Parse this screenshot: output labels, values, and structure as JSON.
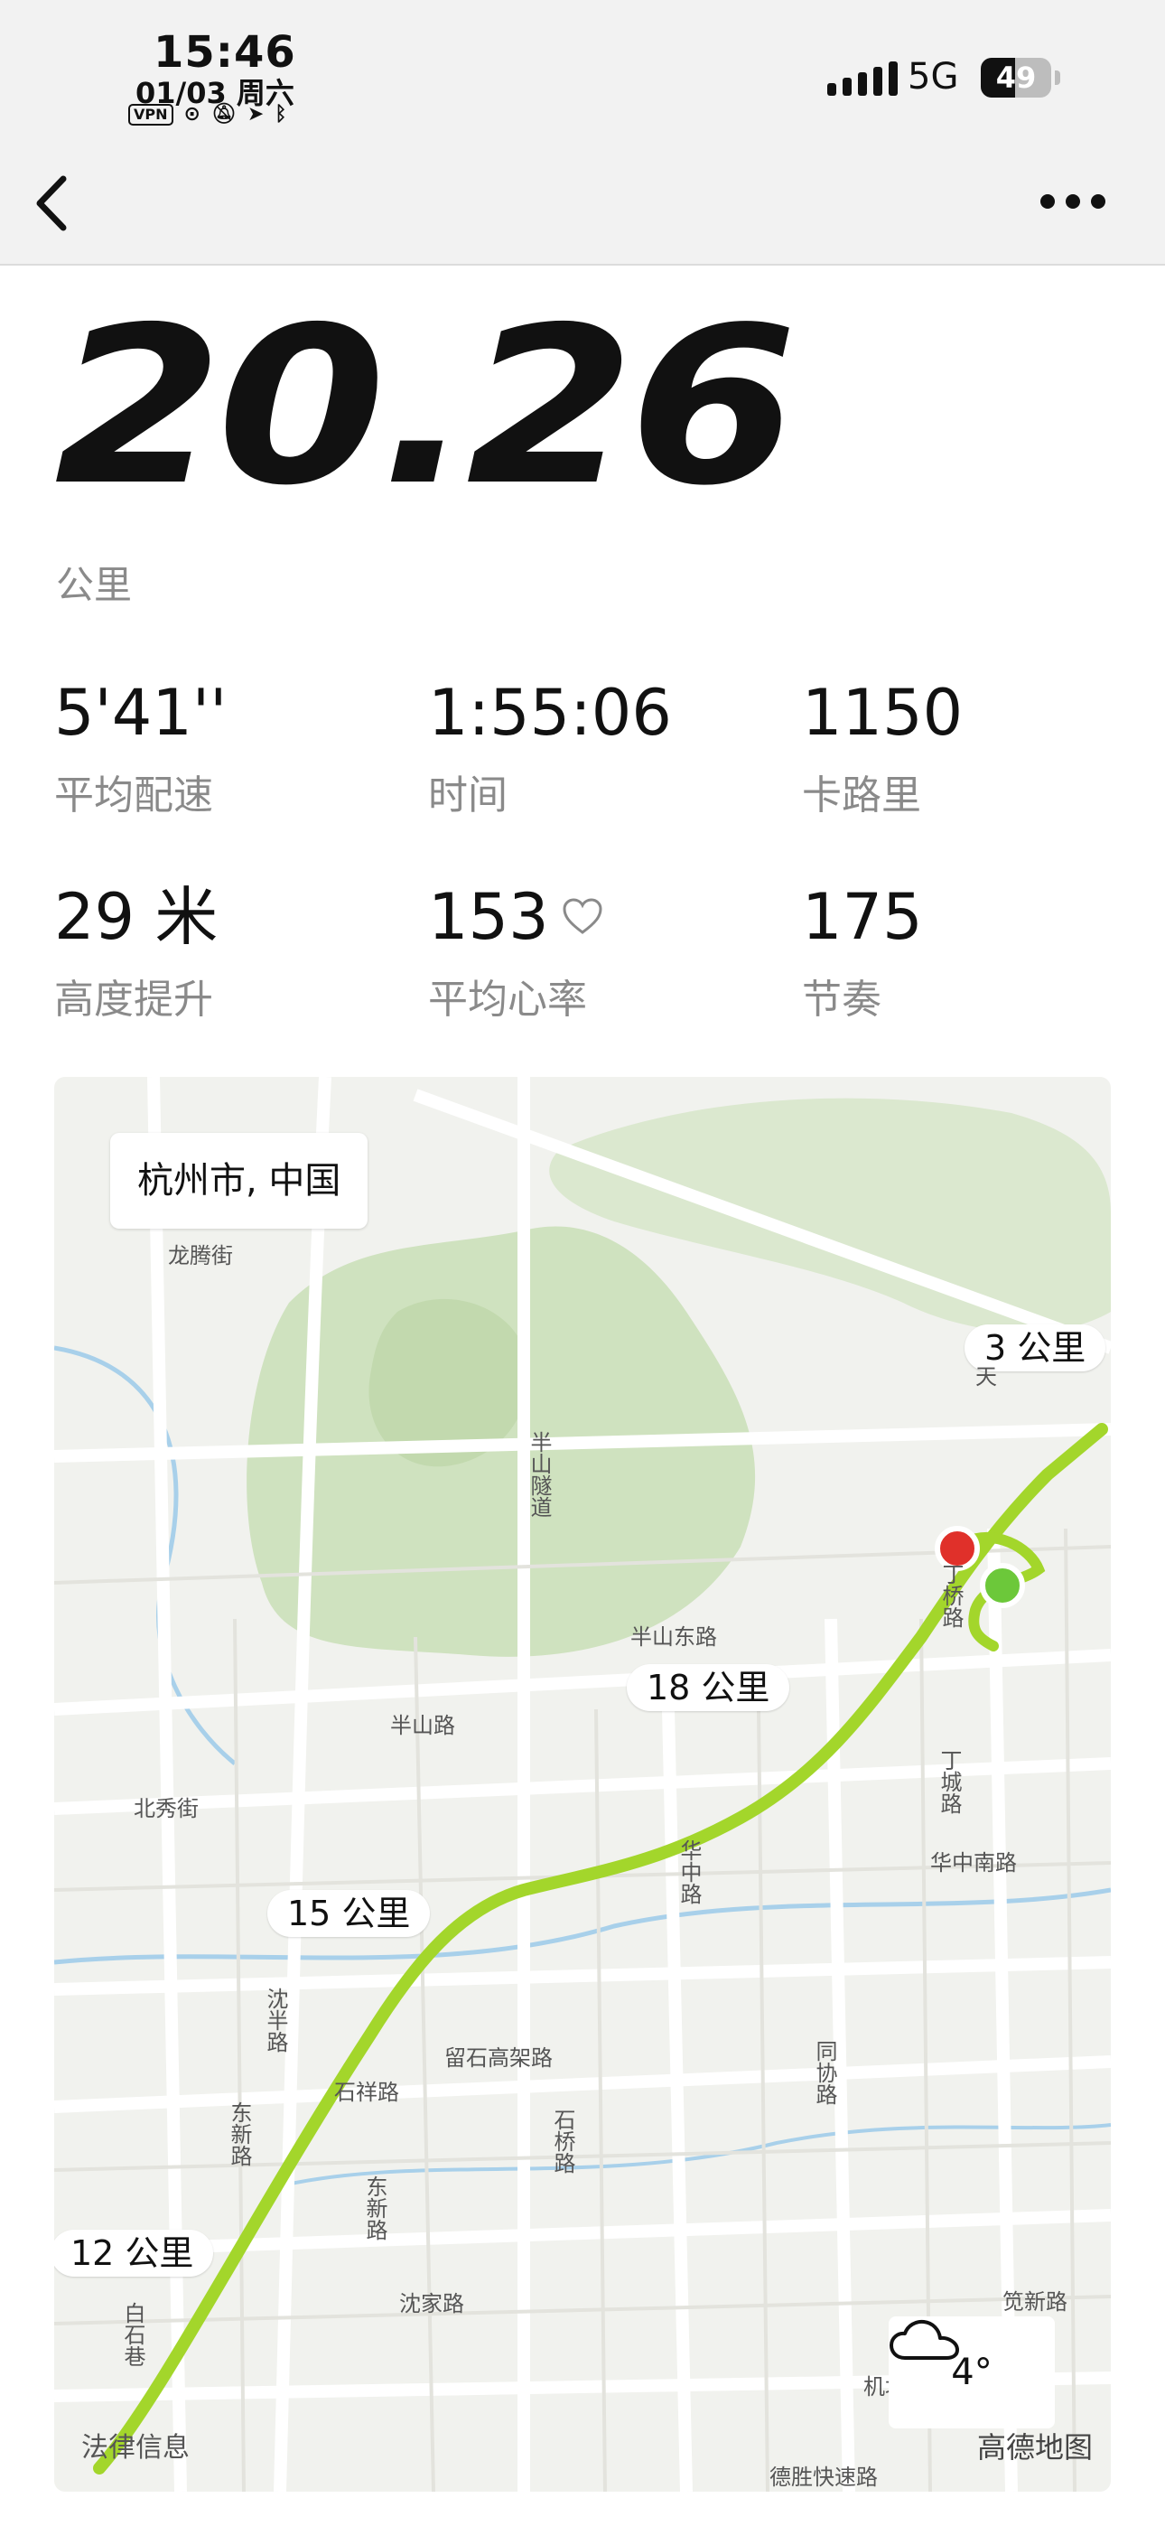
{
  "status_bar": {
    "time": "15:46",
    "date": "01/03 周六",
    "vpn": "VPN",
    "network": "5G",
    "battery_percent": 49
  },
  "distance": {
    "value": "20.26",
    "unit": "公里"
  },
  "stats": [
    {
      "value": "5'41''",
      "label": "平均配速"
    },
    {
      "value": "1:55:06",
      "label": "时间"
    },
    {
      "value": "1150",
      "label": "卡路里"
    },
    {
      "value": "29 米",
      "label": "高度提升"
    },
    {
      "value": "153",
      "label": "平均心率",
      "icon": "heart-icon"
    },
    {
      "value": "175",
      "label": "节奏"
    }
  ],
  "map": {
    "city": "杭州市, 中国",
    "km_markers": [
      "3 公里",
      "18 公里",
      "15 公里",
      "12 公里"
    ],
    "route_color": "#a3d62b",
    "start_color": "#6cc83a",
    "end_color": "#e0302a",
    "road_labels": [
      "龙腾街",
      "半山隧道",
      "半山东路",
      "半山路",
      "北秀街",
      "丁桥路",
      "丁城路",
      "华中路",
      "华中南路",
      "留石高架路",
      "石祥路",
      "石桥路",
      "沈半路",
      "东新路",
      "东新路",
      "沈家路",
      "同协路",
      "笕新路",
      "白石巷",
      "机场路",
      "德胜快速路",
      "天"
    ],
    "weather": {
      "temp": "4°",
      "icon": "cloud-icon"
    },
    "footer_left": "法律信息",
    "footer_right": "高德地图"
  }
}
